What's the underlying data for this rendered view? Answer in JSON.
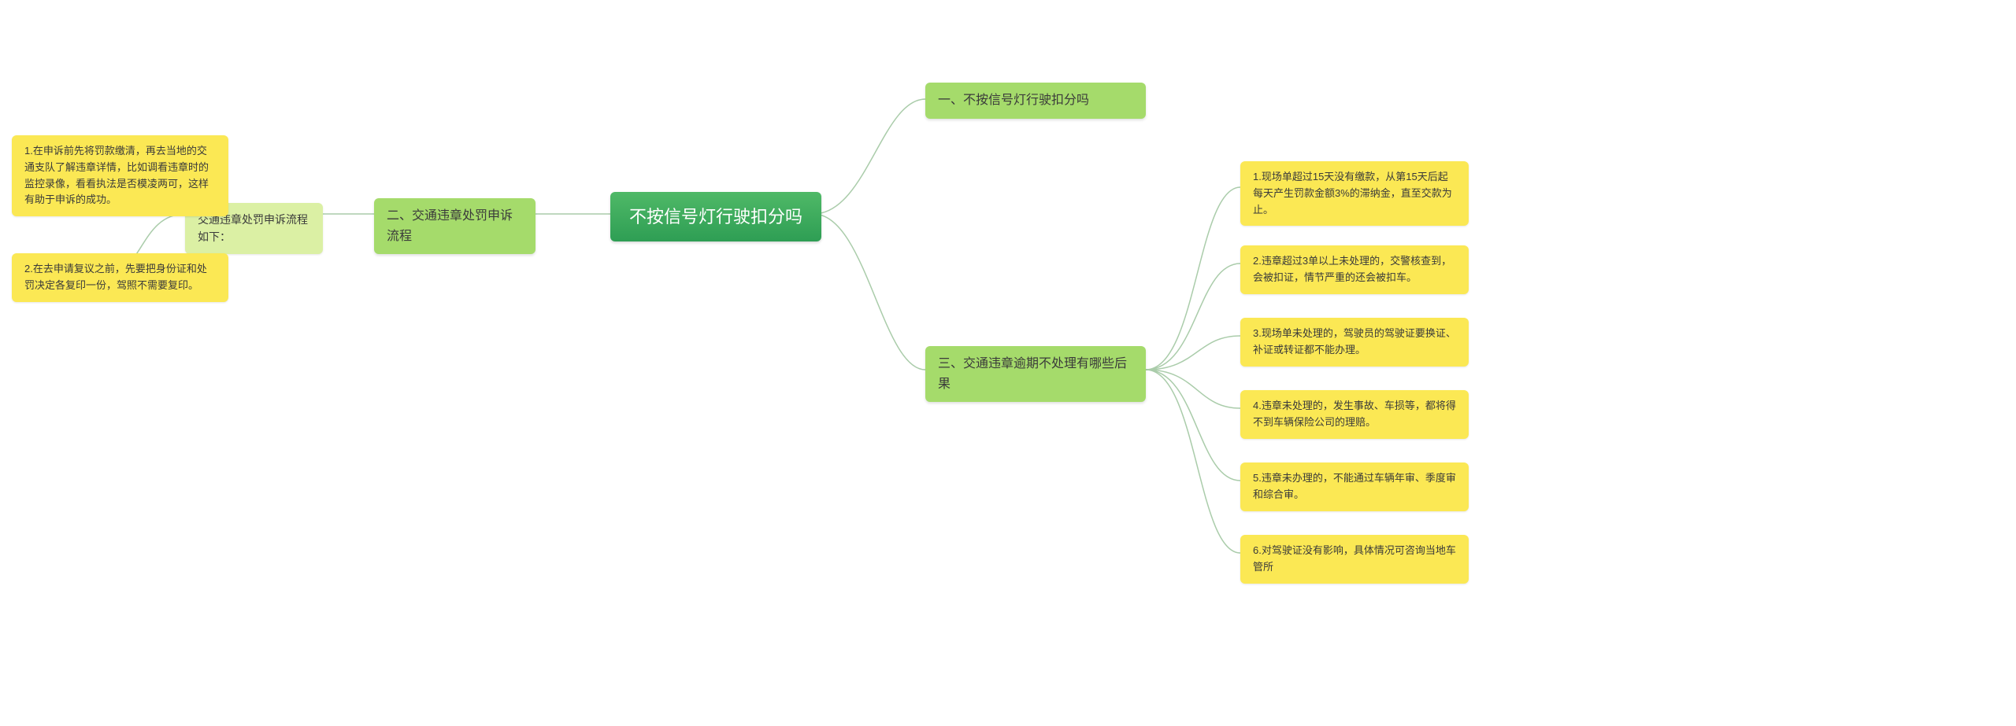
{
  "root": {
    "title": "不按信号灯行驶扣分吗"
  },
  "right": {
    "branch1": {
      "title": "一、不按信号灯行驶扣分吗"
    },
    "branch3": {
      "title": "三、交通违章逾期不处理有哪些后果",
      "leaves": [
        "1.现场单超过15天没有缴款，从第15天后起每天产生罚款金额3%的滞纳金，直至交款为止。",
        "2.违章超过3单以上未处理的，交警核查到，会被扣证，情节严重的还会被扣车。",
        "3.现场单未处理的，驾驶员的驾驶证要换证、补证或转证都不能办理。",
        "4.违章未处理的，发生事故、车损等，都将得不到车辆保险公司的理赔。",
        "5.违章未办理的，不能通过车辆年审、季度审和综合审。",
        "6.对驾驶证没有影响，具体情况可咨询当地车管所"
      ]
    }
  },
  "left": {
    "branch2": {
      "title": "二、交通违章处罚申诉流程",
      "sub": "交通违章处罚申诉流程如下：",
      "leaves": [
        "1.在申诉前先将罚款缴清，再去当地的交通支队了解违章详情，比如调看违章时的监控录像，看看执法是否模凌两可，这样有助于申诉的成功。",
        "2.在去申请复议之前，先要把身份证和处罚决定各复印一份，驾照不需要复印。"
      ]
    }
  }
}
